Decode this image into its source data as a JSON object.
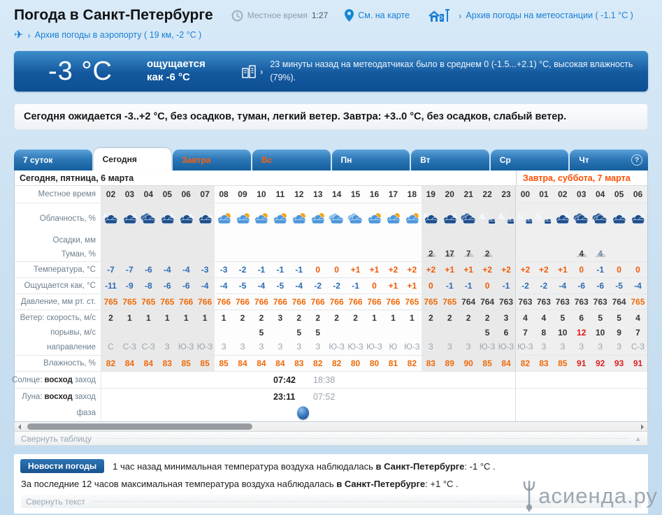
{
  "header": {
    "title": "Погода в Санкт-Петербурге",
    "local_time_label": "Местное время",
    "local_time_value": "1:27",
    "map_link": "См. на карте",
    "station_link": "Архив погоды на метеостанции ( -1.1 °C )",
    "airport_link": "Архив погоды в аэропорту ( 19 км, -2 °C )"
  },
  "banner": {
    "temp_now": "-3 °C",
    "feels_line1": "ощущается",
    "feels_line2": "как -6 °C",
    "sensors_text": "23 минуты назад на метеодатчиках было в среднем 0 (-1.5...+2.1) °C, высокая влажность (79%)."
  },
  "summary_text": "Сегодня ожидается -3..+2 °C, без осадков, туман, легкий ветер. Завтра: +3..0 °C, без осадков, слабый ветер.",
  "tabs": [
    {
      "key": "7days",
      "label": "7 суток",
      "variant": "blue",
      "text": "white"
    },
    {
      "key": "today",
      "label": "Сегодня",
      "variant": "active",
      "text": "dark"
    },
    {
      "key": "tomorrow",
      "label": "Завтра",
      "variant": "blue",
      "text": "orange"
    },
    {
      "key": "sunday",
      "label": "Вс",
      "variant": "blue",
      "text": "orange"
    },
    {
      "key": "monday",
      "label": "Пн",
      "variant": "blue",
      "text": "white"
    },
    {
      "key": "tuesday",
      "label": "Вт",
      "variant": "blue",
      "text": "white"
    },
    {
      "key": "wednesday",
      "label": "Ср",
      "variant": "blue",
      "text": "white"
    },
    {
      "key": "thursday",
      "label": "Чт",
      "variant": "blue",
      "text": "white",
      "has_help": true
    }
  ],
  "help_symbol": "?",
  "table": {
    "today_caption": "Сегодня, пятница, 6 марта",
    "tomorrow_caption": "Завтра, суббота, 7 марта",
    "labels": {
      "time": "Местное время",
      "cloud": "Облачность, %",
      "precip": "Осадки, мм",
      "fog": "Туман, %",
      "temp": "Температура, °C",
      "feels": "Ощущается как, °C",
      "pressure": "Давление, мм рт. ст.",
      "wind_speed": "Ветер: скорость, м/с",
      "wind_gust": "порывы, м/с",
      "wind_dir": "направление",
      "humidity": "Влажность, %",
      "sun_prefix": "Солнце:",
      "rise": "восход",
      "set": "заход",
      "moon_prefix": "Луна:",
      "phase": "фаза"
    },
    "hours": [
      "02",
      "03",
      "04",
      "05",
      "06",
      "07",
      "08",
      "09",
      "10",
      "11",
      "12",
      "13",
      "14",
      "15",
      "16",
      "17",
      "18",
      "19",
      "20",
      "21",
      "22",
      "23",
      "00",
      "01",
      "02",
      "03",
      "04",
      "05",
      "06"
    ],
    "sections": [
      "n",
      "n",
      "n",
      "n",
      "n",
      "n",
      "d",
      "d",
      "d",
      "d",
      "d",
      "d",
      "d",
      "d",
      "d",
      "d",
      "d",
      "n",
      "n",
      "n",
      "n",
      "n",
      "t",
      "t",
      "t",
      "t",
      "t",
      "t",
      "t"
    ],
    "icons": [
      "np",
      "nc",
      "no",
      "nc",
      "nc",
      "nc",
      "dp",
      "dp",
      "dp",
      "dp",
      "dp",
      "dp",
      "do",
      "do",
      "dp",
      "dp",
      "dp",
      "np",
      "nc",
      "no",
      "nm",
      "nm",
      "nm",
      "nm",
      "nc",
      "no",
      "no",
      "nc",
      "nc"
    ],
    "fog": [
      "",
      "",
      "",
      "",
      "",
      "",
      "",
      "",
      "",
      "",
      "",
      "",
      "",
      "",
      "",
      "",
      "",
      "2",
      "17",
      "7",
      "2",
      "",
      "",
      "",
      "",
      "4",
      "4",
      "",
      ""
    ],
    "temperature": [
      "-7",
      "-7",
      "-6",
      "-4",
      "-4",
      "-3",
      "-3",
      "-2",
      "-1",
      "-1",
      "-1",
      "0",
      "0",
      "+1",
      "+1",
      "+2",
      "+2",
      "+2",
      "+1",
      "+1",
      "+2",
      "+2",
      "+2",
      "+2",
      "+1",
      "0",
      "-1",
      "0",
      "0"
    ],
    "feels_like": [
      "-11",
      "-9",
      "-8",
      "-6",
      "-6",
      "-4",
      "-4",
      "-5",
      "-4",
      "-5",
      "-4",
      "-2",
      "-2",
      "-1",
      "0",
      "+1",
      "+1",
      "0",
      "-1",
      "-1",
      "0",
      "-1",
      "-2",
      "-2",
      "-4",
      "-6",
      "-6",
      "-5",
      "-4"
    ],
    "pressure": [
      "765",
      "765",
      "765",
      "765",
      "766",
      "766",
      "766",
      "766",
      "766",
      "766",
      "766",
      "766",
      "766",
      "766",
      "766",
      "766",
      "765",
      "765",
      "765",
      "764",
      "764",
      "763",
      "763",
      "763",
      "763",
      "763",
      "763",
      "764",
      "765"
    ],
    "wind_speed": [
      "2",
      "1",
      "1",
      "1",
      "1",
      "1",
      "1",
      "2",
      "2",
      "3",
      "2",
      "2",
      "2",
      "2",
      "1",
      "1",
      "1",
      "2",
      "2",
      "2",
      "2",
      "3",
      "4",
      "4",
      "5",
      "6",
      "5",
      "5",
      "4"
    ],
    "wind_gusts": [
      "",
      "",
      "",
      "",
      "",
      "",
      "",
      "",
      "5",
      "",
      "5",
      "5",
      "",
      "",
      "",
      "",
      "",
      "",
      "",
      "",
      "5",
      "6",
      "7",
      "8",
      "10",
      "12",
      "10",
      "9",
      "7"
    ],
    "wind_direction": [
      "С",
      "С-З",
      "С-З",
      "З",
      "Ю-З",
      "Ю-З",
      "З",
      "З",
      "З",
      "З",
      "З",
      "З",
      "Ю-З",
      "Ю-З",
      "Ю-З",
      "Ю",
      "Ю-З",
      "З",
      "З",
      "З",
      "Ю-З",
      "Ю-З",
      "Ю-З",
      "З",
      "З",
      "З",
      "З",
      "З",
      "С-З"
    ],
    "humidity": [
      "82",
      "84",
      "84",
      "83",
      "85",
      "85",
      "85",
      "84",
      "84",
      "84",
      "83",
      "82",
      "82",
      "80",
      "80",
      "81",
      "82",
      "83",
      "89",
      "90",
      "85",
      "84",
      "82",
      "83",
      "85",
      "91",
      "92",
      "93",
      "91"
    ],
    "sun": {
      "rise": "07:42",
      "set": "18:38"
    },
    "moon": {
      "rise": "23:11",
      "set": "07:52"
    }
  },
  "collapse_table_label": "Свернуть таблицу",
  "news": {
    "button_label": "Новости погоды",
    "line1_pre": "1 час назад минимальная температура воздуха наблюдалась ",
    "line1_bold": "в Санкт-Петербурге",
    "line1_post": ": -1 °C .",
    "line2_pre": "За последние 12 часов максимальная температура воздуха наблюдалась ",
    "line2_bold": "в Санкт-Петербурге",
    "line2_post": ": +1 °C .",
    "collapse_label": "Свернуть текст"
  },
  "watermark_text": "асиенда.ру",
  "colors": {
    "accent_blue": "#1a7fd4",
    "negative_temp": "#2a6db6",
    "positive_temp": "#f05a0a",
    "humidity_alert": "#e02020",
    "gust_alert": "#e01212",
    "tomorrow_orange": "#ff4e00"
  }
}
